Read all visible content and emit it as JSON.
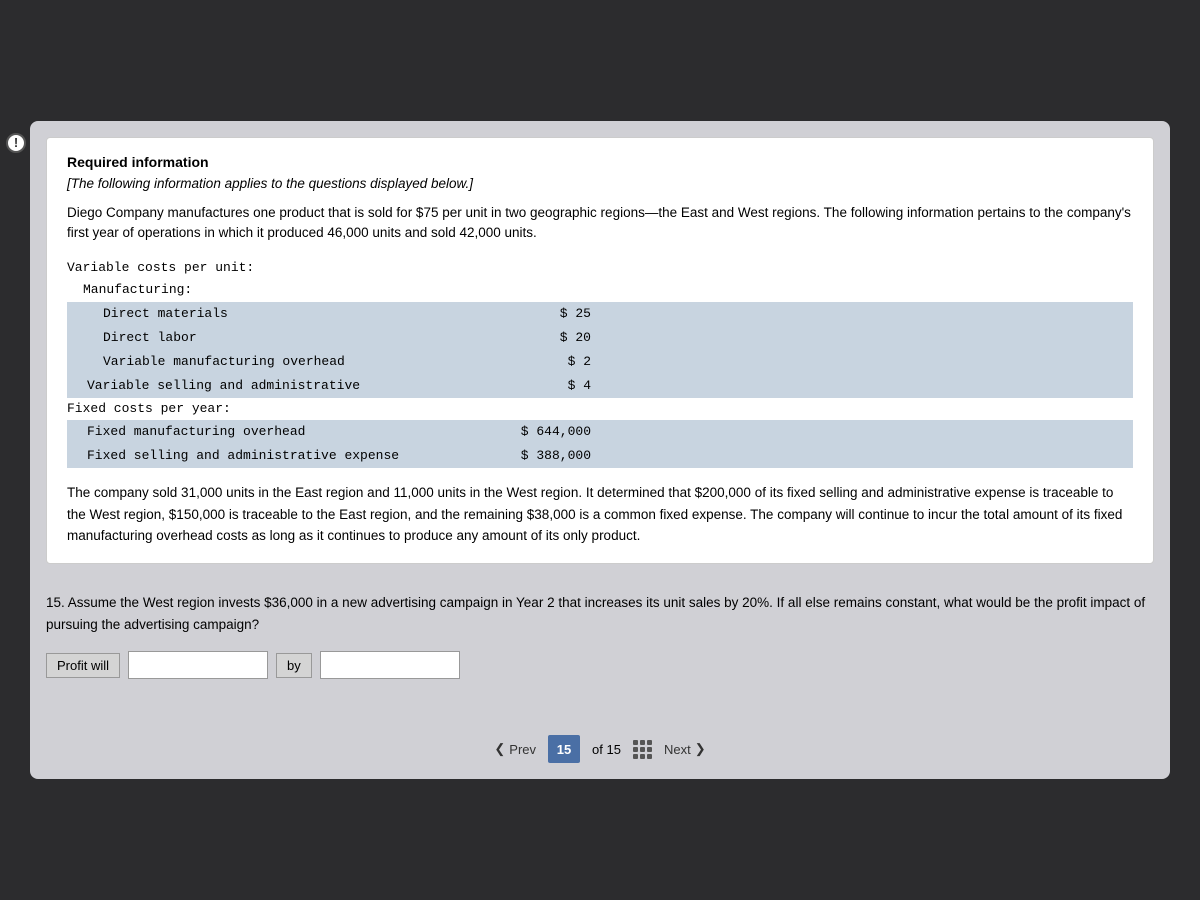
{
  "page": {
    "alert_icon": "!",
    "required_info": {
      "title": "Required information",
      "subtitle": "[The following information applies to the questions displayed below.]",
      "description": "Diego Company manufactures one product that is sold for $75 per unit in two geographic regions—the East and West regions. The following information pertains to the company's first year of operations in which it produced 46,000 units and sold 42,000 units.",
      "cost_data": {
        "variable_costs_label": "Variable costs per unit:",
        "manufacturing_label": "Manufacturing:",
        "direct_materials_label": "Direct materials",
        "direct_materials_value": "$ 25",
        "direct_labor_label": "Direct labor",
        "direct_labor_value": "$ 20",
        "variable_mfg_label": "Variable manufacturing overhead",
        "variable_mfg_value": "$ 2",
        "variable_selling_label": "Variable selling and administrative",
        "variable_selling_value": "$ 4",
        "fixed_costs_label": "Fixed costs per year:",
        "fixed_mfg_label": "Fixed manufacturing overhead",
        "fixed_mfg_value": "$ 644,000",
        "fixed_selling_label": "Fixed selling and administrative expense",
        "fixed_selling_value": "$ 388,000"
      },
      "body_text": "The company sold 31,000 units in the East region and 11,000 units in the West region. It determined that $200,000 of its fixed selling and administrative expense is traceable to the West region, $150,000 is traceable to the East region, and the remaining $38,000 is a common fixed expense. The company will continue to incur the total amount of its fixed manufacturing overhead costs as long as it continues to produce any amount of its only product."
    },
    "question": {
      "number": "15.",
      "text": "Assume the West region invests $36,000 in a new advertising campaign in Year 2 that increases its unit sales by 20%. If all else remains constant, what would be the profit impact of pursuing the advertising campaign?",
      "answer_prefix": "Profit will",
      "answer_by": "by",
      "input1_value": "",
      "input2_value": ""
    },
    "pagination": {
      "prev_label": "Prev",
      "current_page": "15",
      "of_label": "of 15",
      "next_label": "Next"
    }
  }
}
